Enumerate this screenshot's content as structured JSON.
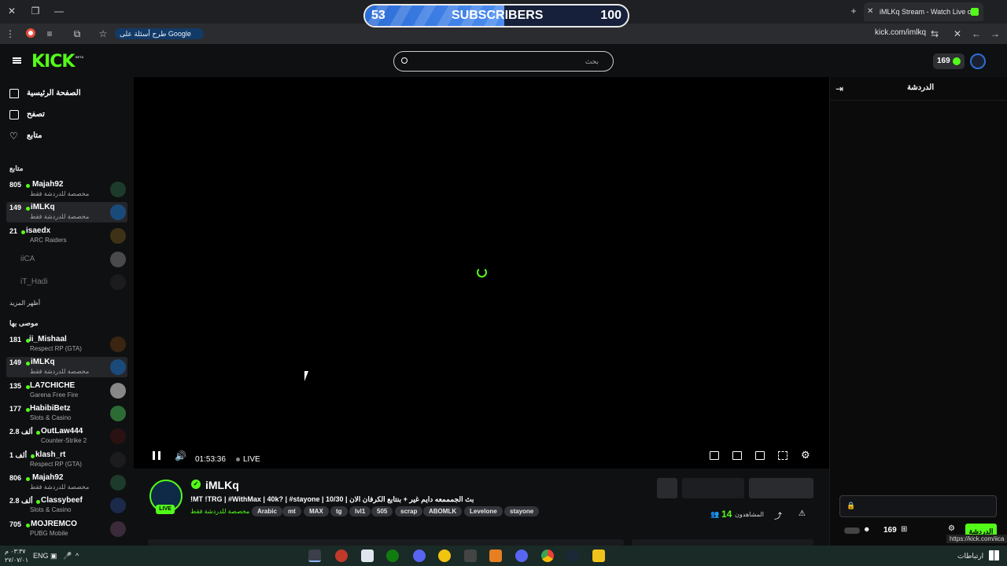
{
  "browser": {
    "tab_title": "iMLKq Stream - Watch Live on",
    "google_chip": "طرح أسئلة على Google",
    "url": "kick.com/imlkq"
  },
  "subscriber_goal": {
    "current": "53",
    "label": "SUBSCRIBERS",
    "target": "100",
    "progress": 0.53
  },
  "header": {
    "logo": "KICK",
    "logo_badge": "BETA",
    "search_placeholder": "بحث",
    "points": "169"
  },
  "sidebar": {
    "nav": [
      {
        "label": "الصفحة الرئيسية",
        "icon": "home-icon"
      },
      {
        "label": "تصفح",
        "icon": "browse-icon"
      },
      {
        "label": "متابع",
        "icon": "heart-icon"
      }
    ],
    "following_title": "متابع",
    "following": [
      {
        "viewers": "805",
        "name": "Majah92",
        "category": "مخصصة للدردشة فقط",
        "live": true
      },
      {
        "viewers": "149",
        "name": "iMLKq",
        "category": "مخصصة للدردشة فقط",
        "live": true,
        "active": true
      },
      {
        "viewers": "21",
        "name": "isaedx",
        "category": "ARC Raiders",
        "live": true
      },
      {
        "viewers": "",
        "name": "iiCA",
        "category": "",
        "live": false
      },
      {
        "viewers": "",
        "name": "iT_Hadi",
        "category": "",
        "live": false
      }
    ],
    "show_more": "أظهر المزيد",
    "recommended_title": "موصى بها",
    "recommended": [
      {
        "viewers": "181",
        "name": "ii_Mishaal",
        "category": "Respect RP (GTA)"
      },
      {
        "viewers": "149",
        "name": "iMLKq",
        "category": "مخصصة للدردشة فقط",
        "active": true
      },
      {
        "viewers": "135",
        "name": "LA7CHICHE",
        "category": "Garena Free Fire"
      },
      {
        "viewers": "177",
        "name": "HabibiBetz",
        "category": "Slots & Casino"
      },
      {
        "viewers": "2.8 ألف",
        "name": "OutLaw444",
        "category": "Counter-Strike 2"
      },
      {
        "viewers": "1 ألف",
        "name": "klash_rt",
        "category": "Respect RP (GTA)"
      },
      {
        "viewers": "806",
        "name": "Majah92",
        "category": "مخصصة للدردشة فقط"
      },
      {
        "viewers": "2.8 ألف",
        "name": "Classybeef",
        "category": "Slots & Casino"
      },
      {
        "viewers": "705",
        "name": "MOJREMCO",
        "category": "PUBG Mobile"
      }
    ]
  },
  "player": {
    "time": "01:53:36",
    "live_label": "LIVE"
  },
  "stream_info": {
    "channel": "iMLKq",
    "live_badge": "LIVE",
    "title": "!MT !TRG | #WithMax | 40k? | #stayone | 10/30 | بث الجمممعه دايم غير + بنتابع الكرفان الان",
    "category": "مخصصة للدردشة فقط",
    "tags": [
      "Arabic",
      "mt",
      "MAX",
      "tg",
      "lvl1",
      "505",
      "scrap",
      "ABOMLK",
      "Levelone",
      "stayone"
    ],
    "viewers_label": "المشاهدون",
    "viewers_count": "14"
  },
  "chat": {
    "title": "الدردشة",
    "send_label": "الدردشة",
    "points": "169",
    "status_url": "https://kick.com/iica"
  },
  "taskbar": {
    "lang": "ENG",
    "time": "٠٣:٣٧ م",
    "date": "٢٧/٠٧/٠١",
    "right_label": "ارتباطات"
  }
}
